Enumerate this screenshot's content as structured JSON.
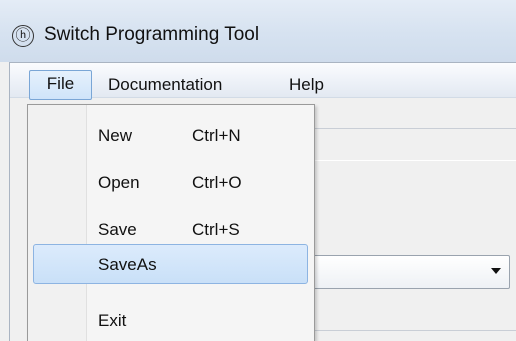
{
  "window": {
    "title": "Switch Programming Tool",
    "app_icon_glyph": "ⓗ",
    "app_icon_name": "app-logo-icon"
  },
  "menubar": {
    "items": [
      {
        "label": "File",
        "active": true
      },
      {
        "label": "Documentation"
      },
      {
        "label": "Help"
      }
    ]
  },
  "file_menu": {
    "items": [
      {
        "label": "New",
        "shortcut": "Ctrl+N"
      },
      {
        "label": "Open",
        "shortcut": "Ctrl+O"
      },
      {
        "label": "Save",
        "shortcut": "Ctrl+S"
      },
      {
        "label": "SaveAs",
        "shortcut": "",
        "highlighted": true
      },
      {
        "label": "Exit",
        "shortcut": ""
      }
    ]
  },
  "colors": {
    "highlight_border": "#8db4e2",
    "highlight_fill": "#c9e0f8",
    "titlebar": "#d6e2f0"
  },
  "icons": {
    "combo_arrow": "dropdown-arrow-icon"
  }
}
